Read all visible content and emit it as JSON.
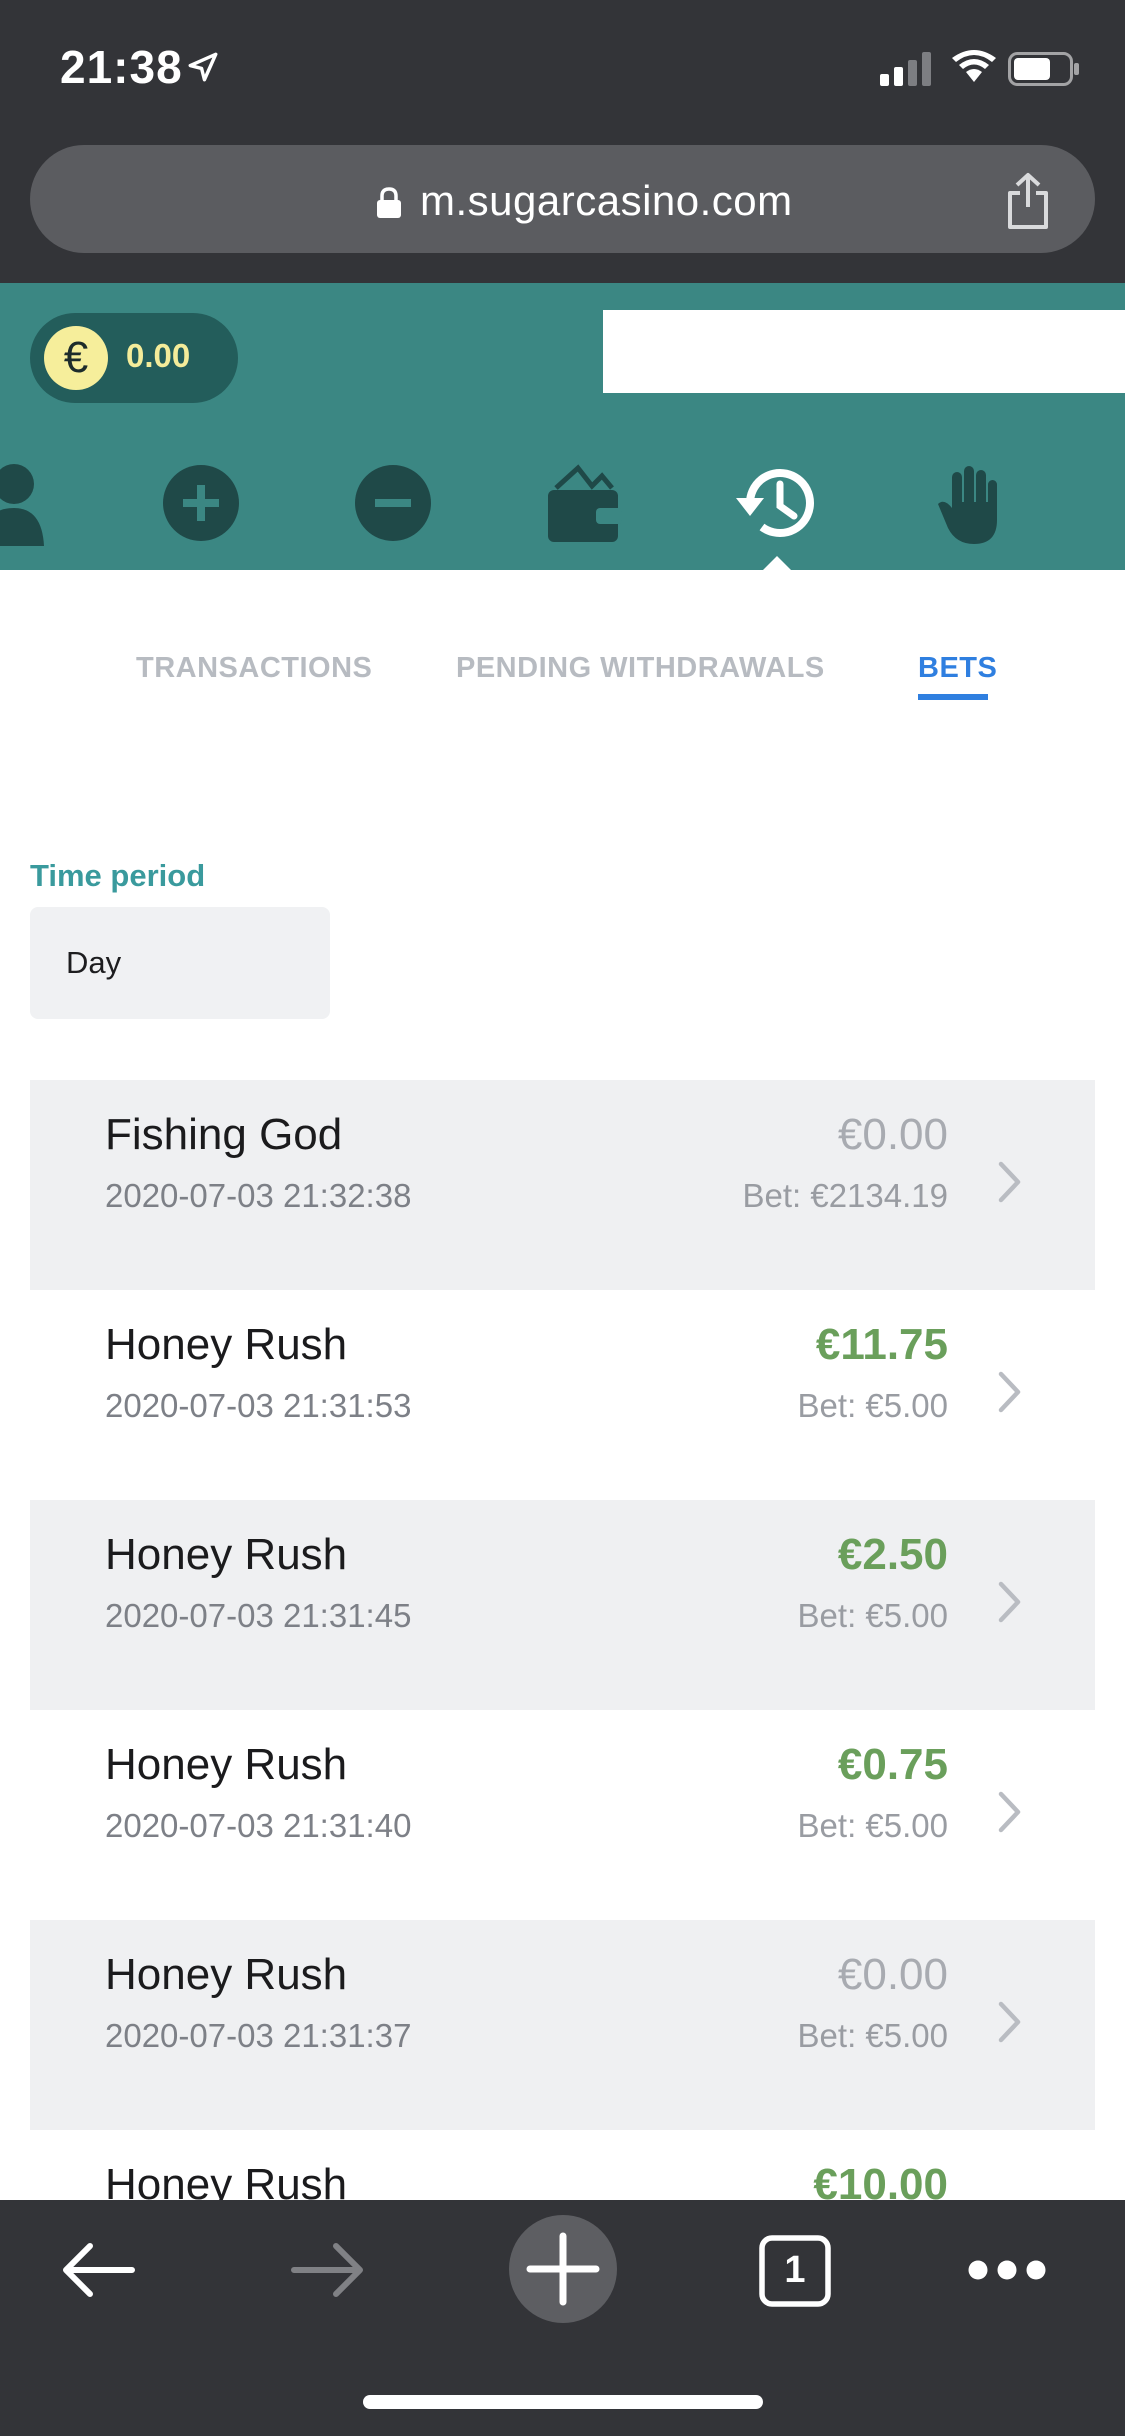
{
  "status_bar": {
    "time": "21:38"
  },
  "browser": {
    "url": "m.sugarcasino.com"
  },
  "header": {
    "currency_symbol": "€",
    "balance": "0.00",
    "nav_icons": [
      "user-icon",
      "plus-circle-icon",
      "minus-circle-icon",
      "wallet-icon",
      "history-icon",
      "hand-icon"
    ],
    "active_nav": "history-icon"
  },
  "tabs": [
    {
      "label": "TRANSACTIONS",
      "active": false
    },
    {
      "label": "PENDING WITHDRAWALS",
      "active": false
    },
    {
      "label": "BETS",
      "active": true
    }
  ],
  "filter": {
    "label": "Time period",
    "value": "Day"
  },
  "bets": [
    {
      "game": "Fishing God",
      "datetime": "2020-07-03 21:32:38",
      "win": "€0.00",
      "bet": "Bet: €2134.19",
      "positive": false
    },
    {
      "game": "Honey Rush",
      "datetime": "2020-07-03 21:31:53",
      "win": "€11.75",
      "bet": "Bet: €5.00",
      "positive": true
    },
    {
      "game": "Honey Rush",
      "datetime": "2020-07-03 21:31:45",
      "win": "€2.50",
      "bet": "Bet: €5.00",
      "positive": true
    },
    {
      "game": "Honey Rush",
      "datetime": "2020-07-03 21:31:40",
      "win": "€0.75",
      "bet": "Bet: €5.00",
      "positive": true
    },
    {
      "game": "Honey Rush",
      "datetime": "2020-07-03 21:31:37",
      "win": "€0.00",
      "bet": "Bet: €5.00",
      "positive": false
    },
    {
      "game": "Honey Rush",
      "datetime": "",
      "win": "€10.00",
      "bet": "",
      "positive": true
    }
  ],
  "toolbar": {
    "tab_count": "1"
  },
  "colors": {
    "header_teal": "#3b8783",
    "tab_active": "#2f7fe0",
    "win_green": "#6a9f5b",
    "label_teal": "#3a9a9d"
  }
}
